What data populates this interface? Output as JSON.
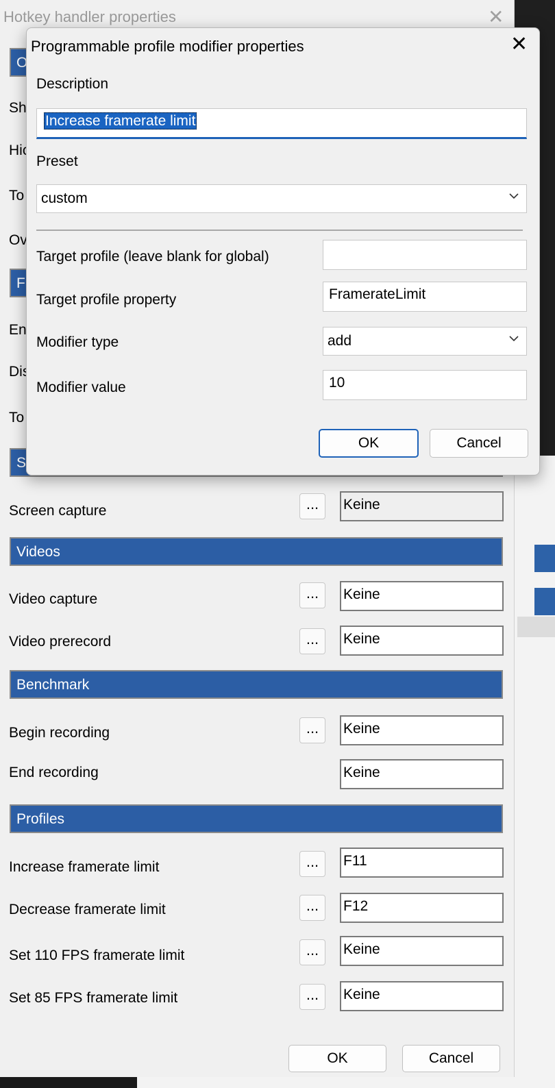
{
  "back_window": {
    "title": "Hotkey handler properties",
    "clipped_labels": [
      "Sh",
      "Hic",
      "To",
      "Ov",
      "En",
      "Dis",
      "To"
    ],
    "clipped_sections": [
      "O",
      "F",
      "S"
    ],
    "sections": {
      "screenshots_row": {
        "label": "Screen capture",
        "key": "Keine"
      },
      "videos": {
        "title": "Videos",
        "rows": [
          {
            "label": "Video capture",
            "key": "Keine"
          },
          {
            "label": "Video prerecord",
            "key": "Keine"
          }
        ]
      },
      "benchmark": {
        "title": "Benchmark",
        "rows": [
          {
            "label": "Begin recording",
            "key": "Keine"
          },
          {
            "label": "End recording",
            "key": "Keine"
          }
        ]
      },
      "profiles": {
        "title": "Profiles",
        "rows": [
          {
            "label": "Increase framerate limit",
            "key": "F11"
          },
          {
            "label": "Decrease framerate limit",
            "key": "F12"
          },
          {
            "label": "Set 110 FPS framerate limit",
            "key": "Keine"
          },
          {
            "label": "Set 85 FPS framerate limit",
            "key": "Keine"
          }
        ]
      }
    },
    "dots_label": "...",
    "ok_label": "OK",
    "cancel_label": "Cancel"
  },
  "dialog": {
    "title": "Programmable profile modifier properties",
    "close_glyph": "✕",
    "description_label": "Description",
    "description_value": "Increase framerate limit",
    "preset_label": "Preset",
    "preset_value": "custom",
    "target_profile_label": "Target profile (leave blank for global)",
    "target_profile_value": "",
    "target_property_label": "Target profile property",
    "target_property_value": "FramerateLimit",
    "modifier_type_label": "Modifier type",
    "modifier_type_value": "add",
    "modifier_value_label": "Modifier value",
    "modifier_value_value": "10",
    "ok_label": "OK",
    "cancel_label": "Cancel"
  },
  "colors": {
    "section_header": "#2c5ea5",
    "selection": "#1a64c2",
    "focus_border": "#1e62b8"
  },
  "icons": [
    "close-icon",
    "chevron-down-icon"
  ]
}
